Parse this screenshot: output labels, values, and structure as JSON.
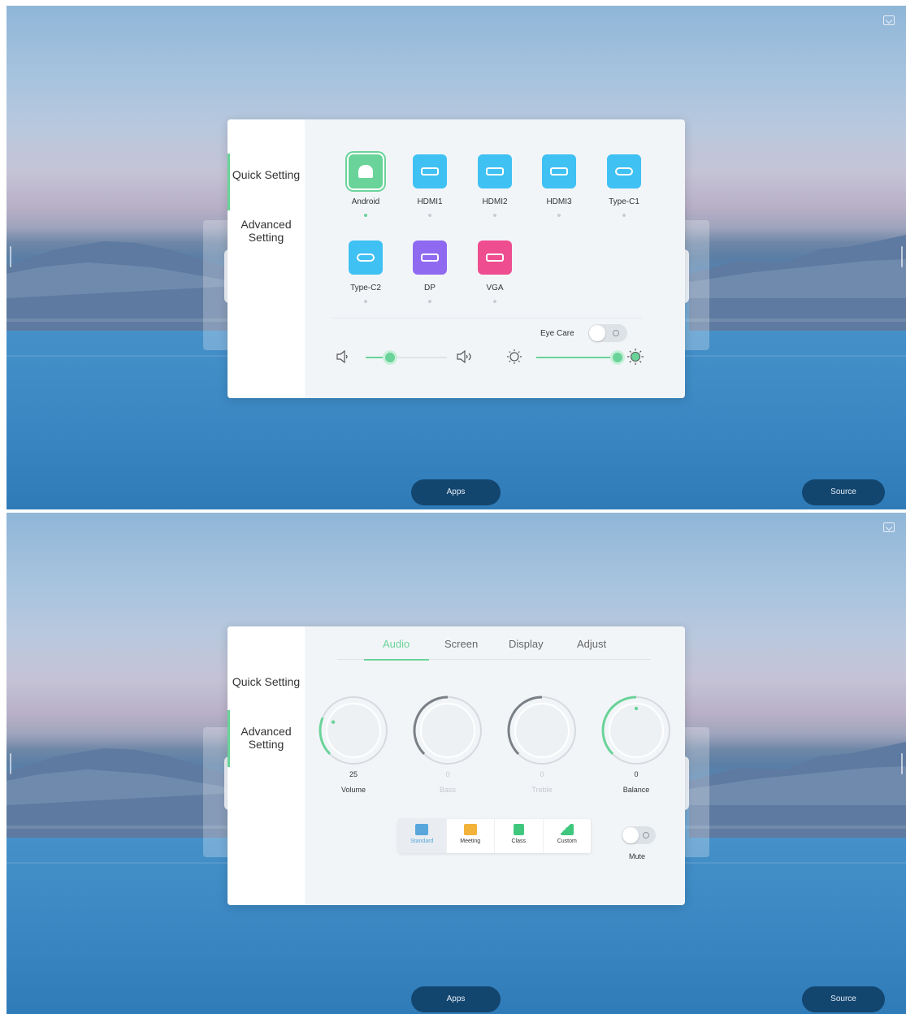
{
  "top": {
    "sidebar": [
      {
        "label": "Quick Setting",
        "active": true
      },
      {
        "label": "Advanced Setting",
        "active": false
      }
    ],
    "sources": [
      {
        "label": "Android",
        "icon": "android-icon",
        "color": "#6ad399",
        "selected": true
      },
      {
        "label": "HDMI1",
        "icon": "hdmi-icon",
        "color": "#40c1f3",
        "selected": false
      },
      {
        "label": "HDMI2",
        "icon": "hdmi-icon",
        "color": "#40c1f3",
        "selected": false
      },
      {
        "label": "HDMI3",
        "icon": "hdmi-icon",
        "color": "#40c1f3",
        "selected": false
      },
      {
        "label": "Type-C1",
        "icon": "usb-c-icon",
        "color": "#40c1f3",
        "selected": false
      },
      {
        "label": "Type-C2",
        "icon": "usb-c-icon",
        "color": "#40c1f3",
        "selected": false
      },
      {
        "label": "DP",
        "icon": "displayport-icon",
        "color": "#8f6af0",
        "selected": false
      },
      {
        "label": "VGA",
        "icon": "vga-icon",
        "color": "#ee4d8f",
        "selected": false
      }
    ],
    "eye_care_label": "Eye Care",
    "eye_care_on": false,
    "volume_level": 0.3,
    "brightness_level": 1.0
  },
  "bottom": {
    "sidebar": [
      {
        "label": "Quick Setting",
        "active": false
      },
      {
        "label": "Advanced Setting",
        "active": true
      }
    ],
    "tabs": [
      "Audio",
      "Screen",
      "Display",
      "Adjust"
    ],
    "active_tab": "Audio",
    "dials": [
      {
        "name": "Volume",
        "value": "25",
        "enabled": true,
        "level": 0.25
      },
      {
        "name": "Bass",
        "value": "0",
        "enabled": false,
        "level": 0.5
      },
      {
        "name": "Treble",
        "value": "0",
        "enabled": false,
        "level": 0.5
      },
      {
        "name": "Balance",
        "value": "0",
        "enabled": true,
        "level": 0.5
      }
    ],
    "modes": [
      {
        "label": "Standard",
        "color": "#58a6dc",
        "active": true
      },
      {
        "label": "Meeting",
        "color": "#f3b23a",
        "active": false
      },
      {
        "label": "Class",
        "color": "#3fc77e",
        "active": false
      },
      {
        "label": "Custom",
        "color": "#3fc77e",
        "active": false
      }
    ],
    "mute_label": "Mute",
    "mute_on": false
  },
  "dock": {
    "apps_label": "Apps",
    "source_label": "Source"
  },
  "colors": {
    "accent": "#6ad399",
    "dock": "#13466f"
  }
}
